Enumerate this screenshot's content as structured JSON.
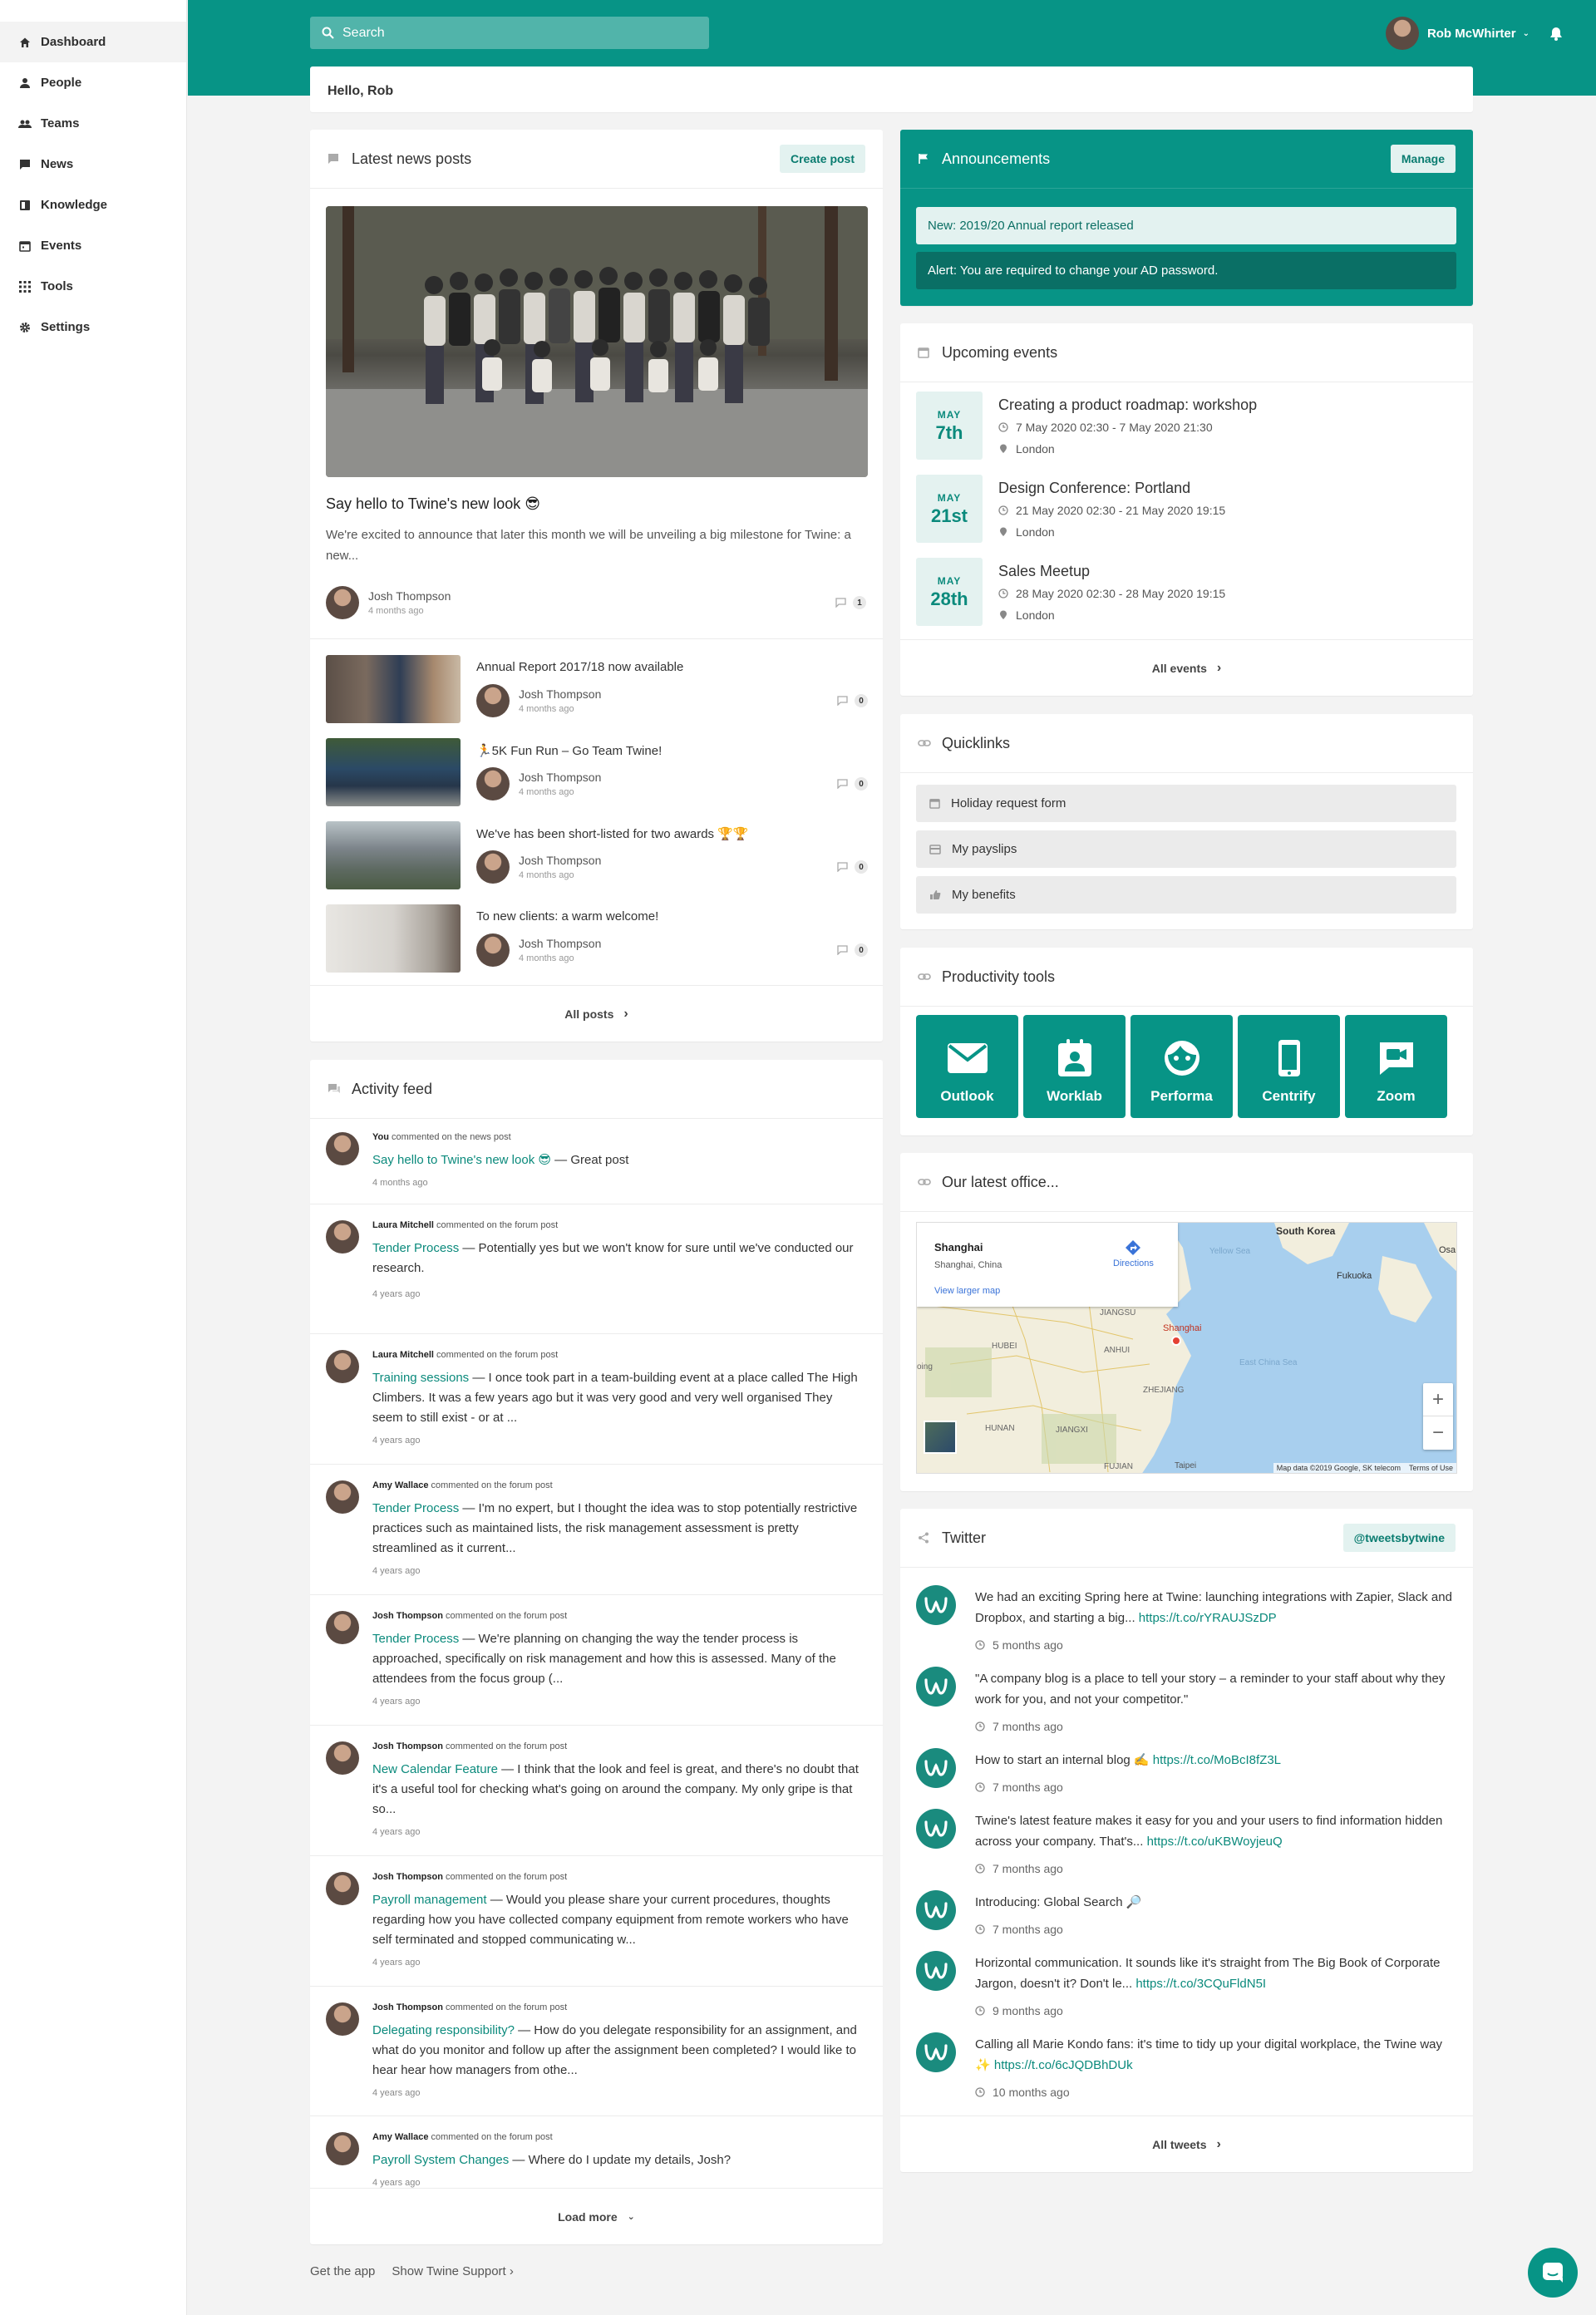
{
  "sidebar": {
    "items": [
      {
        "label": "Dashboard",
        "icon": "home-icon"
      },
      {
        "label": "People",
        "icon": "person-icon"
      },
      {
        "label": "Teams",
        "icon": "team-icon"
      },
      {
        "label": "News",
        "icon": "news-icon"
      },
      {
        "label": "Knowledge",
        "icon": "book-icon"
      },
      {
        "label": "Events",
        "icon": "calendar-icon"
      },
      {
        "label": "Tools",
        "icon": "grid-icon"
      },
      {
        "label": "Settings",
        "icon": "gear-icon"
      }
    ]
  },
  "topbar": {
    "search_placeholder": "Search",
    "user_name": "Rob McWhirter",
    "accent": "#079486"
  },
  "greeting": "Hello, Rob",
  "news": {
    "title": "Latest news posts",
    "create_label": "Create post",
    "featured": {
      "title": "Say hello to Twine's new look 😎",
      "excerpt": "We're excited to announce that later this month we will be unveiling a big milestone for Twine: a new...",
      "author": "Josh Thompson",
      "time": "4 months ago",
      "comments": "1"
    },
    "posts": [
      {
        "title": "Annual Report 2017/18 now available",
        "author": "Josh Thompson",
        "time": "4 months ago",
        "comments": "0"
      },
      {
        "title": "🏃5K Fun Run – Go Team Twine!",
        "author": "Josh Thompson",
        "time": "4 months ago",
        "comments": "0"
      },
      {
        "title": "We've has been short-listed for two awards 🏆🏆",
        "author": "Josh Thompson",
        "time": "4 months ago",
        "comments": "0"
      },
      {
        "title": "To new clients: a warm welcome!",
        "author": "Josh Thompson",
        "time": "4 months ago",
        "comments": "0"
      }
    ],
    "all_label": "All posts"
  },
  "activity": {
    "title": "Activity feed",
    "items": [
      {
        "who": "You",
        "action": "commented on the news post",
        "link": "Say hello to Twine's new look 😎",
        "text": " — Great post",
        "time": "4 months ago"
      },
      {
        "who": "Laura Mitchell",
        "action": "commented on the forum post",
        "link": "Tender Process",
        "text": " — Potentially yes but we won't know for sure until we've conducted our research.",
        "time": "4 years ago"
      },
      {
        "who": "Laura Mitchell",
        "action": "commented on the forum post",
        "link": "Training sessions",
        "text": " — I once took part in a team-building event at a place called The High Climbers. It was a few years ago but it was very good and very well organised They seem to still exist - or at ...",
        "time": "4 years ago"
      },
      {
        "who": "Amy Wallace",
        "action": "commented on the forum post",
        "link": "Tender Process",
        "text": " — I'm no expert, but I thought the idea was to stop potentially restrictive practices such as maintained lists, the risk management assessment is pretty streamlined as it current...",
        "time": "4 years ago"
      },
      {
        "who": "Josh Thompson",
        "action": "commented on the forum post",
        "link": "Tender Process",
        "text": " — We're planning on changing the way the tender process is approached, specifically on risk management and how this is assessed. Many of the attendees from the focus group (...",
        "time": "4 years ago"
      },
      {
        "who": "Josh Thompson",
        "action": "commented on the forum post",
        "link": "New Calendar Feature",
        "text": " — I think that the look and feel is great, and there's no doubt that it's a useful tool for checking what's going on around the company.  My only gripe is that so...",
        "time": "4 years ago"
      },
      {
        "who": "Josh Thompson",
        "action": "commented on the forum post",
        "link": "Payroll management",
        "text": " — Would you please share your current procedures, thoughts regarding how you have collected company equipment from remote workers who have self terminated and stopped communicating w...",
        "time": "4 years ago"
      },
      {
        "who": "Josh Thompson",
        "action": "commented on the forum post",
        "link": "Delegating responsibility?",
        "text": " — How do you delegate responsibility for an assignment, and what do you monitor and follow up after the assignment been completed? I would like to hear hear how managers from othe...",
        "time": "4 years ago"
      },
      {
        "who": "Amy Wallace",
        "action": "commented on the forum post",
        "link": "Payroll System Changes",
        "text": " — Where do I update my details, Josh?",
        "time": "4 years ago"
      }
    ],
    "load_more": "Load more"
  },
  "announcements": {
    "title": "Announcements",
    "manage_label": "Manage",
    "items": [
      "New: 2019/20 Annual report released",
      "Alert: You are required to change your AD password."
    ]
  },
  "events": {
    "title": "Upcoming events",
    "items": [
      {
        "month": "MAY",
        "day": "7th",
        "title": "Creating a product roadmap: workshop",
        "time": "7 May 2020 02:30 - 7 May 2020 21:30",
        "location": "London"
      },
      {
        "month": "MAY",
        "day": "21st",
        "title": "Design Conference: Portland",
        "time": "21 May 2020 02:30 - 21 May 2020 19:15",
        "location": "London"
      },
      {
        "month": "MAY",
        "day": "28th",
        "title": "Sales Meetup",
        "time": "28 May 2020 02:30 - 28 May 2020 19:15",
        "location": "London"
      }
    ],
    "all_label": "All events"
  },
  "quicklinks": {
    "title": "Quicklinks",
    "items": [
      "Holiday request form",
      "My payslips",
      "My benefits"
    ]
  },
  "tools": {
    "title": "Productivity tools",
    "items": [
      {
        "label": "Outlook",
        "icon": "mail-icon"
      },
      {
        "label": "Worklab",
        "icon": "badge-icon"
      },
      {
        "label": "Performa",
        "icon": "face-icon"
      },
      {
        "label": "Centrify",
        "icon": "phone-icon"
      },
      {
        "label": "Zoom",
        "icon": "video-icon"
      }
    ]
  },
  "office": {
    "title": "Our latest office...",
    "place": "Shanghai",
    "region": "Shanghai, China",
    "directions": "Directions",
    "view_larger": "View larger map",
    "labels": [
      "South Korea",
      "Yellow Sea",
      "Fukuoka",
      "Osa",
      "JIANGSU",
      "Shanghai",
      "HUBEI",
      "ANHUI",
      "East China Sea",
      "ZHEJIANG",
      "oing",
      "HUNAN",
      "JIANGXI",
      "FUJIAN",
      "Taipei"
    ],
    "attribution": "Map data ©2019 Google, SK telecom",
    "terms": "Terms of Use"
  },
  "twitter": {
    "title": "Twitter",
    "handle": "@tweetsbytwine",
    "tweets": [
      {
        "text": "We had an exciting Spring here at Twine: launching integrations with Zapier, Slack and Dropbox, and starting a big... ",
        "link": "https://t.co/rYRAUJSzDP",
        "time": "5 months ago"
      },
      {
        "text": "\"A company blog is a place to tell your story – a reminder to your staff about why they work for you, and not your competitor.\"",
        "link": "",
        "time": "7 months ago"
      },
      {
        "text": "How to start an internal blog ✍️ ",
        "link": "https://t.co/MoBcI8fZ3L",
        "time": "7 months ago"
      },
      {
        "text": "Twine's latest feature makes it easy for you and your users to find information hidden across your company. That's... ",
        "link": "https://t.co/uKBWoyjeuQ",
        "time": "7 months ago"
      },
      {
        "text": "Introducing: Global Search 🔎",
        "link": "",
        "time": "7 months ago"
      },
      {
        "text": "Horizontal communication. It sounds like it's straight from The Big Book of Corporate Jargon, doesn't it? Don't le... ",
        "link": "https://t.co/3CQuFldN5I",
        "time": "9 months ago"
      },
      {
        "text": "Calling all Marie Kondo fans: it's time to tidy up your digital workplace, the Twine way ✨ ",
        "link": "https://t.co/6cJQDBhDUk",
        "time": "10 months ago"
      }
    ],
    "all_label": "All tweets"
  },
  "footer": {
    "get_app": "Get the app",
    "support": "Show Twine Support"
  }
}
